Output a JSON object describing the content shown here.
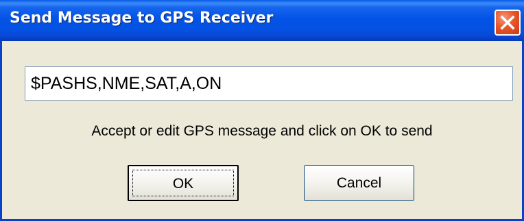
{
  "window": {
    "title": "Send Message to GPS Receiver"
  },
  "title_bar_buttons": {
    "close_icon": "close-icon"
  },
  "message": {
    "value": "$PASHS,NME,SAT,A,ON"
  },
  "instruction": {
    "text": "Accept or edit GPS message and click on OK to send"
  },
  "buttons": {
    "ok_label": "OK",
    "cancel_label": "Cancel"
  },
  "colors": {
    "title_bar": "#0353E6",
    "dialog_bg": "#ECE9D8",
    "close_button": "#E8562A"
  }
}
